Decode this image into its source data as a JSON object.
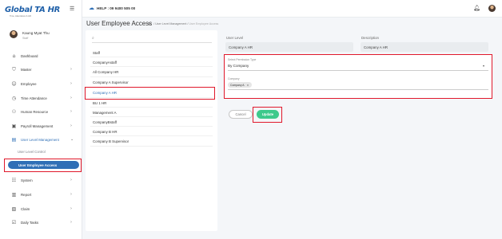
{
  "brand": {
    "logo_text": "Global TA HR",
    "logo_sub": "Time, Attendance & HR"
  },
  "user": {
    "name": "Kaung Myat Thu",
    "role": "Staff"
  },
  "topbar": {
    "help": "HELP : 09 9400 505 00"
  },
  "page": {
    "title": "User Employee Access",
    "breadcrumb": [
      "User Level Management",
      "User Employee Access"
    ]
  },
  "sidebar": {
    "items": [
      {
        "label": "Dashboard",
        "icon": "home-icon",
        "chevron": false
      },
      {
        "label": "Master",
        "icon": "shield-icon",
        "chevron": true
      },
      {
        "label": "Employee",
        "icon": "people-icon",
        "chevron": true
      },
      {
        "label": "Time Attendance",
        "icon": "clock-icon",
        "chevron": true
      },
      {
        "label": "Human Resource",
        "icon": "users-icon",
        "chevron": true
      },
      {
        "label": "Payroll Management",
        "icon": "money-icon",
        "chevron": true
      },
      {
        "label": "User Level Management",
        "icon": "user-level-icon",
        "chevron": true
      },
      {
        "label": "System",
        "icon": "list-icon",
        "chevron": true
      },
      {
        "label": "Report",
        "icon": "report-icon",
        "chevron": true
      },
      {
        "label": "Claim",
        "icon": "claim-icon",
        "chevron": true
      },
      {
        "label": "Daily Tasks",
        "icon": "task-icon",
        "chevron": true
      }
    ],
    "sub_items": [
      "User Level Control",
      "User Employee Access"
    ]
  },
  "list": {
    "search_placeholder": "",
    "items": [
      "Staff",
      "CompanyAstaff",
      "All Company HR",
      "Company A Supervisor",
      "Company A HR",
      "BU 1 HR",
      "Management A",
      "CompanyBstaff",
      "Company B HR",
      "Company B Supervisor"
    ],
    "selected": "Company A HR"
  },
  "form": {
    "user_level_label": "User Level",
    "user_level_value": "Company A HR",
    "description_label": "Description",
    "description_value": "Company A HR",
    "permission_type_label": "Select Permission Type",
    "permission_type_value": "By Company",
    "company_label": "Company",
    "company_chip": "Company A",
    "cancel_label": "Cancel",
    "update_label": "Update"
  },
  "colors": {
    "primary": "#2f6fb6",
    "success": "#3ec98c",
    "highlight": "#e0182b"
  }
}
